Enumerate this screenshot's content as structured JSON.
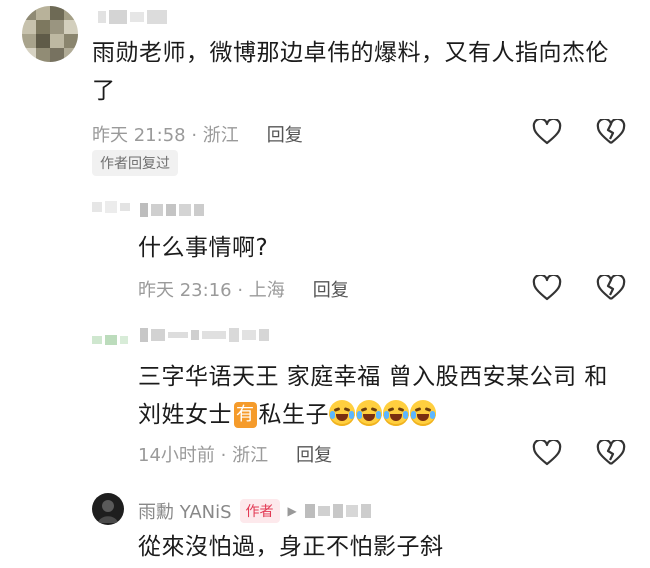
{
  "comments": [
    {
      "content": "雨勋老师，微博那边卓伟的爆料，又有人指向杰伦了",
      "time": "昨天 21:58",
      "location": "浙江",
      "reply_label": "回复",
      "author_tag": "作者回复过"
    },
    {
      "content": "什么事情啊?",
      "time": "昨天 23:16",
      "location": "上海",
      "reply_label": "回复"
    },
    {
      "content_before": "三字华语天王 家庭幸福 曾入股西安某公司 和刘姓女士",
      "badge": "有",
      "content_after": "私生子",
      "emoji_name": "laughing-crying-emoji",
      "time": "14小时前",
      "location": "浙江",
      "reply_label": "回复"
    },
    {
      "author_name": "雨勳 YANiS",
      "author_badge": "作者",
      "content": "從來沒怕過，身正不怕影子斜"
    }
  ],
  "separator": " · ",
  "icons": [
    "like-heart-icon",
    "dislike-broken-heart-icon",
    "play-arrow-icon"
  ],
  "colors": {
    "badge_orange": "#f59b2b",
    "author_red": "#e23a55",
    "meta_gray": "#9a9a9a"
  }
}
